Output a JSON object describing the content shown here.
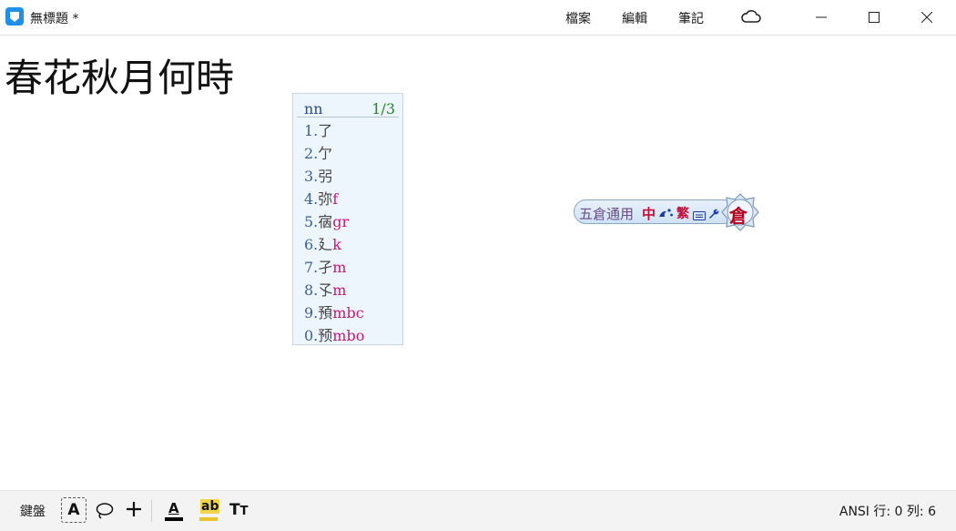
{
  "window": {
    "title": "無標題 *",
    "menus": {
      "file": "檔案",
      "edit": "編輯",
      "note": "筆記"
    }
  },
  "document": {
    "text": "春花秋月何時"
  },
  "candidates": {
    "code": "nn",
    "page": "1/3",
    "items": [
      {
        "num": "1.",
        "char": "了",
        "hint": ""
      },
      {
        "num": "2.",
        "char": "亇",
        "hint": ""
      },
      {
        "num": "3.",
        "char": "弜",
        "hint": ""
      },
      {
        "num": "4.",
        "char": "弥",
        "hint": "f"
      },
      {
        "num": "5.",
        "char": "㝛",
        "hint": "gr"
      },
      {
        "num": "6.",
        "char": "廴",
        "hint": "k"
      },
      {
        "num": "7.",
        "char": "孑",
        "hint": "m"
      },
      {
        "num": "8.",
        "char": "孓",
        "hint": "m"
      },
      {
        "num": "9.",
        "char": "預",
        "hint": "mbc"
      },
      {
        "num": "0.",
        "char": "预",
        "hint": "mbo"
      }
    ]
  },
  "ime": {
    "name": "五倉通用",
    "mode": "中",
    "trad": "繁",
    "logo": "倉"
  },
  "toolbar": {
    "keyboard_label": "鍵盤",
    "ime_button": "A",
    "font_color_letter": "A",
    "highlight_letter": "ab",
    "size_big": "T",
    "size_small": "T",
    "status": "ANSI 行: 0 列: 6"
  },
  "colors": {
    "app_icon": "#1e90e8",
    "candidate_bg": "#eef6fd",
    "candidate_text": "#2b4d8a",
    "candidate_hint": "#c2187a",
    "candidate_page": "#1f8a1f",
    "ime_accent": "#c0123a",
    "highlight": "#f2d44a",
    "toolbar_bg": "#f3f3f3"
  }
}
